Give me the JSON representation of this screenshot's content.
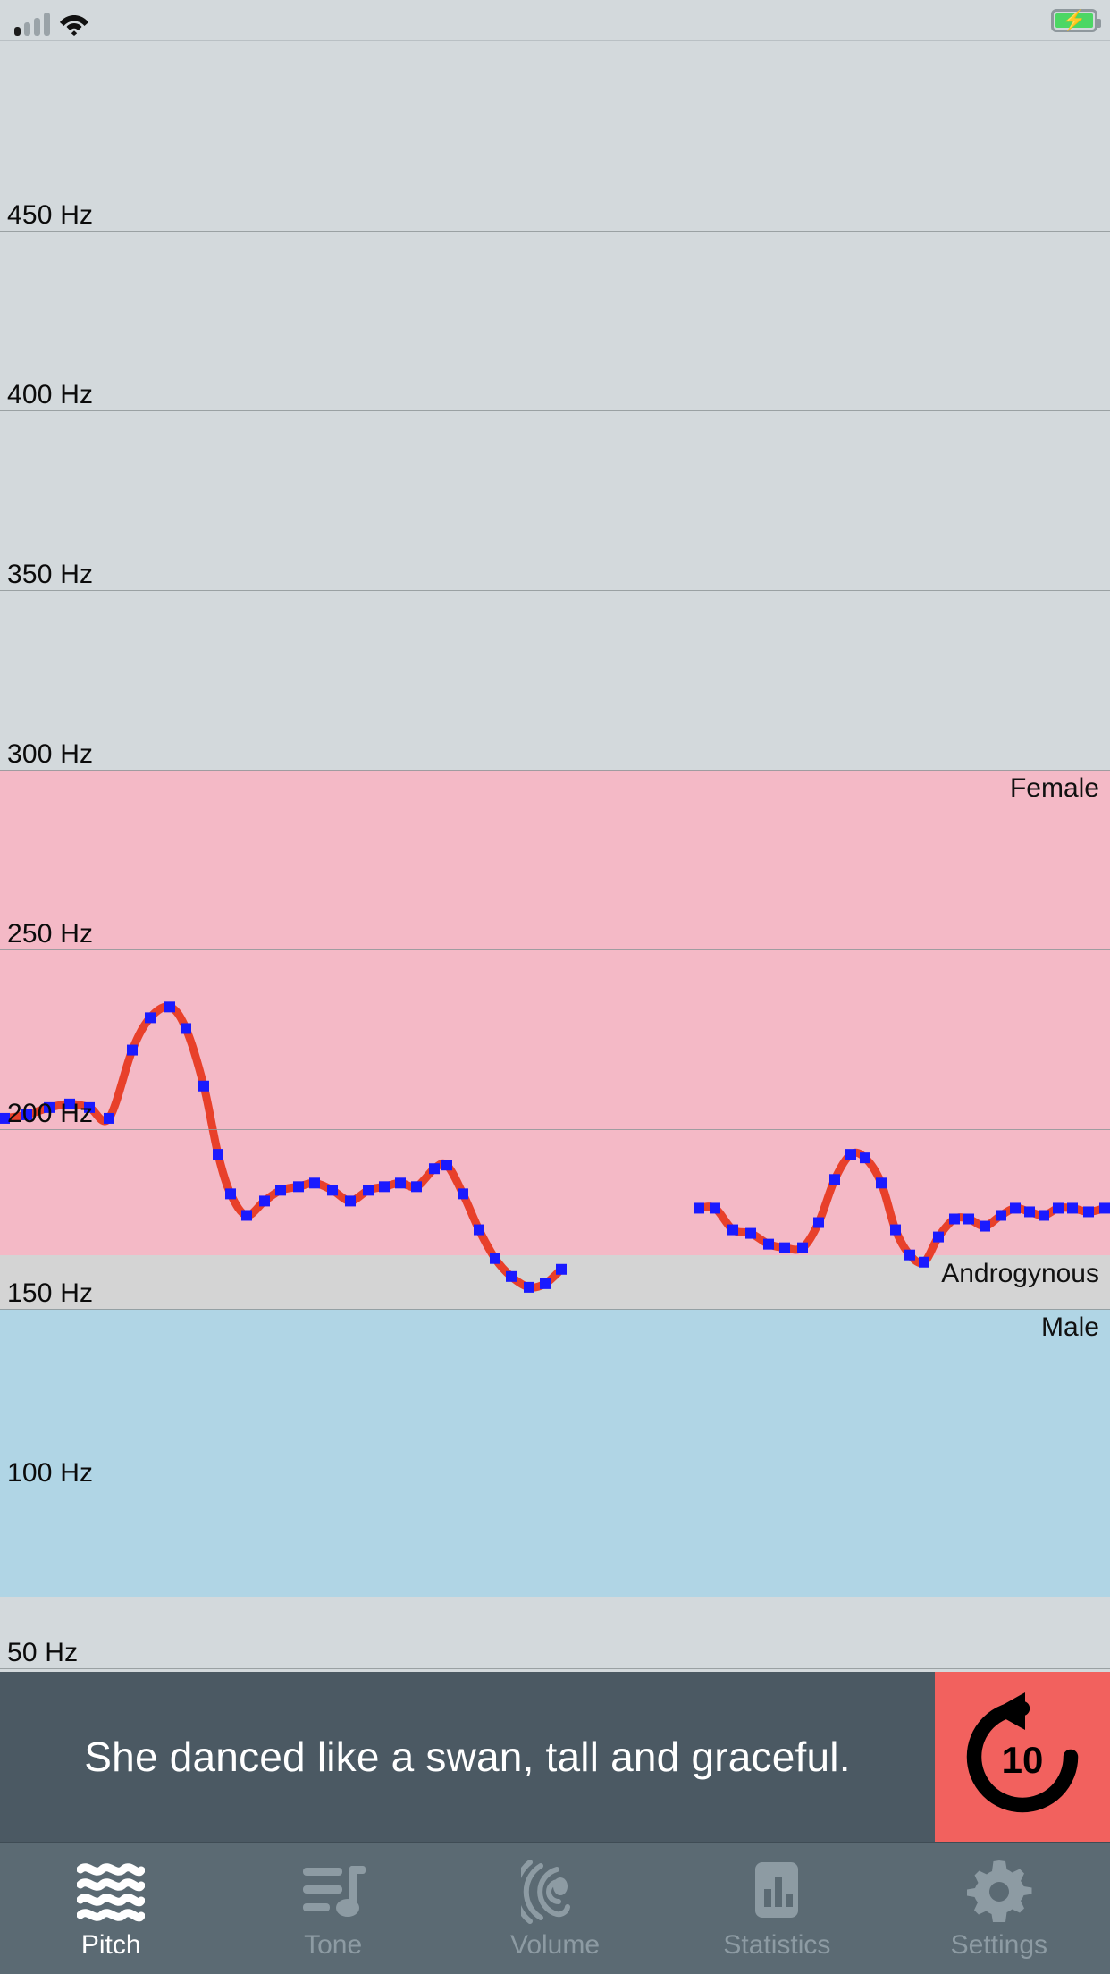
{
  "status_bar": {
    "signal_icon": "cellular-signal-icon",
    "wifi_icon": "wifi-icon",
    "battery_icon": "battery-charging-icon",
    "battery_bolt": "⚡"
  },
  "chart_data": {
    "type": "line",
    "title": "",
    "xlabel": "",
    "ylabel": "Hz",
    "ylim": [
      40,
      470
    ],
    "grid": true,
    "tick_labels": [
      "450 Hz",
      "400 Hz",
      "350 Hz",
      "300 Hz",
      "250 Hz",
      "200 Hz",
      "150 Hz",
      "100 Hz",
      "50 Hz"
    ],
    "ticks": [
      450,
      400,
      350,
      300,
      250,
      200,
      150,
      100,
      50
    ],
    "zones": [
      {
        "name": "Female",
        "label": "Female",
        "from": 165,
        "to": 300,
        "color": "#f4b9c6"
      },
      {
        "name": "Androgynous",
        "label": "Androgynous",
        "from": 150,
        "to": 165,
        "color": "#d4d4d4"
      },
      {
        "name": "Male",
        "label": "Male",
        "from": 70,
        "to": 150,
        "color": "#b0d5e5"
      }
    ],
    "line_color": "#e8402a",
    "point_color": "#1a1aff",
    "series": [
      {
        "name": "segment-1",
        "points": [
          [
            5,
            203
          ],
          [
            30,
            204
          ],
          [
            55,
            206
          ],
          [
            78,
            207
          ],
          [
            100,
            206
          ],
          [
            122,
            203
          ],
          [
            148,
            222
          ],
          [
            168,
            231
          ],
          [
            190,
            234
          ],
          [
            208,
            228
          ],
          [
            228,
            212
          ],
          [
            244,
            193
          ],
          [
            258,
            182
          ],
          [
            276,
            176
          ],
          [
            296,
            180
          ],
          [
            314,
            183
          ],
          [
            334,
            184
          ],
          [
            352,
            185
          ],
          [
            372,
            183
          ],
          [
            392,
            180
          ],
          [
            412,
            183
          ],
          [
            430,
            184
          ],
          [
            448,
            185
          ],
          [
            466,
            184
          ],
          [
            486,
            189
          ],
          [
            500,
            190
          ],
          [
            518,
            182
          ],
          [
            536,
            172
          ],
          [
            554,
            164
          ],
          [
            572,
            159
          ],
          [
            592,
            156
          ],
          [
            610,
            157
          ],
          [
            628,
            161
          ]
        ]
      },
      {
        "name": "segment-2",
        "points": [
          [
            782,
            178
          ],
          [
            800,
            178
          ],
          [
            820,
            172
          ],
          [
            840,
            171
          ],
          [
            860,
            168
          ],
          [
            878,
            167
          ],
          [
            898,
            167
          ],
          [
            916,
            174
          ],
          [
            934,
            186
          ],
          [
            952,
            193
          ],
          [
            968,
            192
          ],
          [
            986,
            185
          ],
          [
            1002,
            172
          ],
          [
            1018,
            165
          ],
          [
            1034,
            163
          ],
          [
            1050,
            170
          ],
          [
            1068,
            175
          ],
          [
            1084,
            175
          ],
          [
            1102,
            173
          ],
          [
            1120,
            176
          ],
          [
            1136,
            178
          ],
          [
            1152,
            177
          ],
          [
            1168,
            176
          ],
          [
            1184,
            178
          ],
          [
            1200,
            178
          ],
          [
            1218,
            177
          ],
          [
            1236,
            178
          ]
        ]
      }
    ]
  },
  "caption": {
    "text": "She danced like a swan, tall and graceful.",
    "replay_label": "10",
    "replay_icon": "replay-10-icon"
  },
  "tabs": [
    {
      "id": "pitch",
      "label": "Pitch",
      "icon": "waves-icon",
      "active": true
    },
    {
      "id": "tone",
      "label": "Tone",
      "icon": "music-note-icon",
      "active": false
    },
    {
      "id": "volume",
      "label": "Volume",
      "icon": "ear-icon",
      "active": false
    },
    {
      "id": "statistics",
      "label": "Statistics",
      "icon": "bar-chart-icon",
      "active": false
    },
    {
      "id": "settings",
      "label": "Settings",
      "icon": "gear-icon",
      "active": false
    }
  ],
  "colors": {
    "background": "#d3d9dc",
    "female": "#f4b9c6",
    "androgynous": "#d4d4d4",
    "male": "#b0d5e5",
    "line": "#e8402a",
    "point": "#1a1aff",
    "caption_bg": "#4b5963",
    "replay_bg": "#f2615e",
    "tabbar_bg": "#5b6a73"
  }
}
